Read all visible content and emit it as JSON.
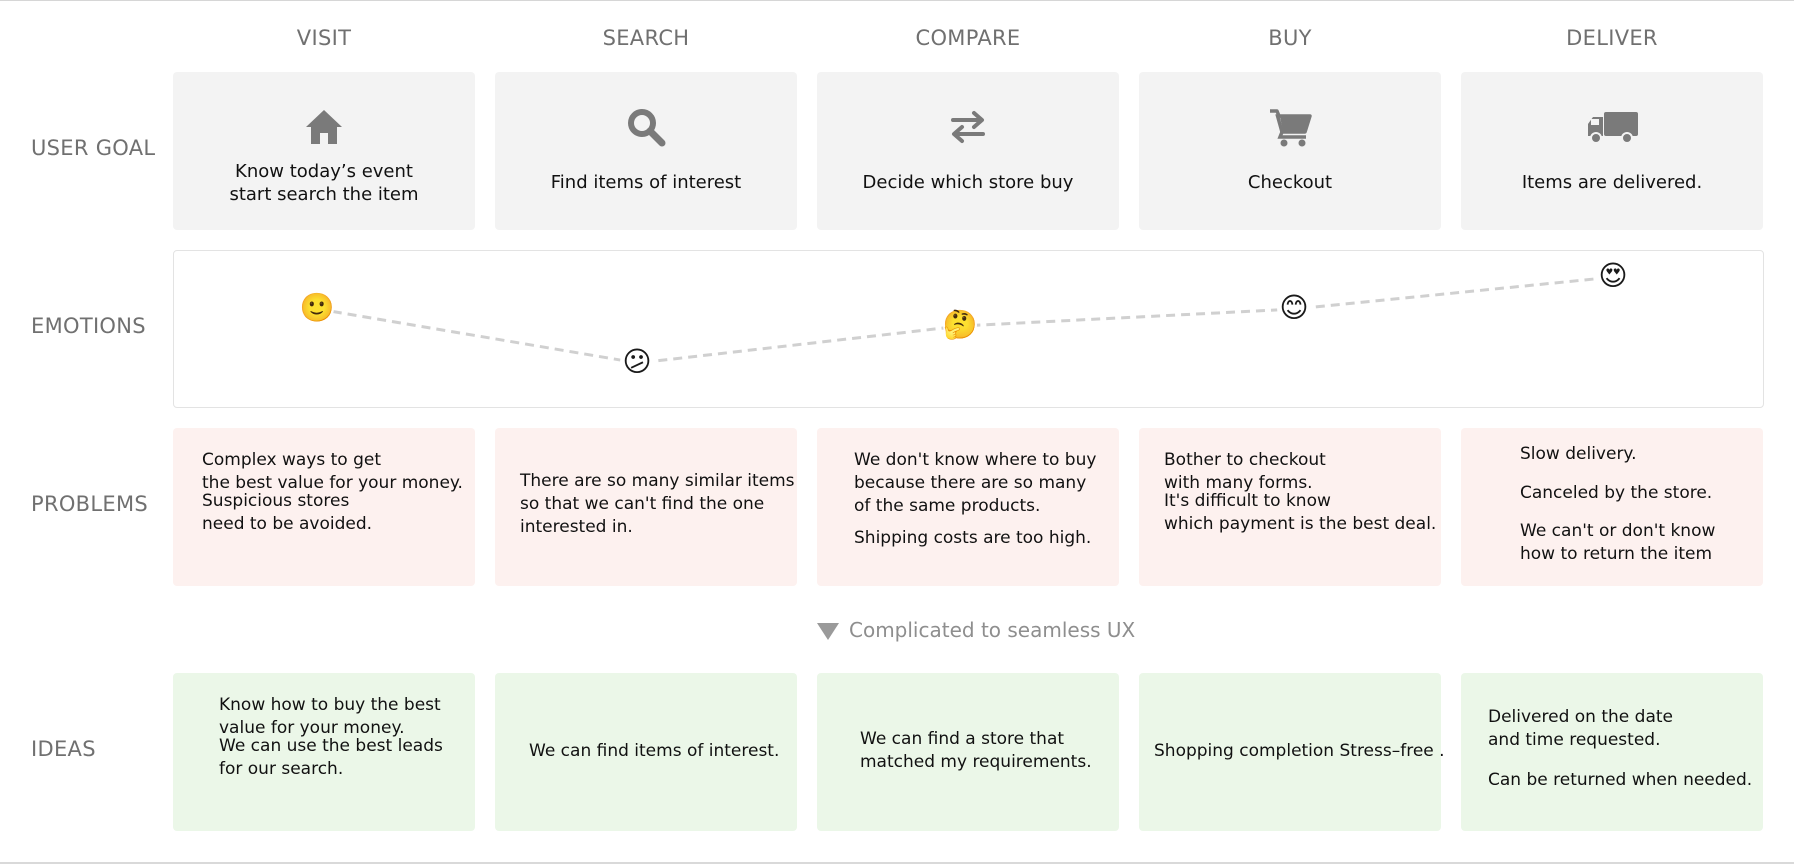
{
  "stages": [
    "VISIT",
    "SEARCH",
    "COMPARE",
    "BUY",
    "DELIVER"
  ],
  "row_labels": {
    "goal": "USER GOAL",
    "emotions": "EMOTIONS",
    "problems": "PROBLEMS",
    "ideas": "IDEAS"
  },
  "goals": [
    {
      "icon": "home-icon",
      "line1": "Know today’s event",
      "line2": "start search the item"
    },
    {
      "icon": "search-icon",
      "line1": "Find items of interest"
    },
    {
      "icon": "compare-arrows-icon",
      "line1": "Decide which store buy"
    },
    {
      "icon": "cart-icon",
      "line1": "Checkout"
    },
    {
      "icon": "truck-icon",
      "line1": "Items are delivered."
    }
  ],
  "emotions": [
    {
      "stage": "VISIT",
      "face": "🙂",
      "name": "slightly-smiling-face"
    },
    {
      "stage": "SEARCH",
      "face": "😕",
      "name": "confused-face"
    },
    {
      "stage": "COMPARE",
      "face": "🤔",
      "name": "thinking-face"
    },
    {
      "stage": "BUY",
      "face": "😊",
      "name": "smiling-face"
    },
    {
      "stage": "DELIVER",
      "face": "😍",
      "name": "heart-eyes-face"
    }
  ],
  "problems": [
    [
      "Complex ways to get",
      "the best value for your money.",
      "Suspicious stores",
      "need to be avoided."
    ],
    [
      "There are so many similar items",
      "so that we can't find the one",
      "interested in."
    ],
    [
      "We don't know where to buy",
      "because there are so many",
      "of the same products.",
      "Shipping costs are too high."
    ],
    [
      "Bother to checkout",
      "with many forms.",
      "It's difficult to know",
      "which payment is the best deal."
    ],
    [
      "Slow delivery.",
      "Canceled by the store.",
      "We can't or don't know",
      "how to return the item"
    ]
  ],
  "divider_label": "Complicated to seamless UX",
  "ideas": [
    [
      "Know how to buy the best",
      "value for your money.",
      "We can use the best leads",
      "for our search."
    ],
    [
      "We can find items of interest."
    ],
    [
      "We can find a store that",
      "matched my requirements."
    ],
    [
      "Shopping completion Stress–free ."
    ],
    [
      "Delivered on the date",
      "and time requested.",
      "Can be returned when needed."
    ]
  ],
  "colors": {
    "goal_bg": "#f3f3f3",
    "problem_bg": "#fdf1ef",
    "idea_bg": "#ebf7e8",
    "icon": "#7a7a7a",
    "line": "#d0d0d0"
  }
}
